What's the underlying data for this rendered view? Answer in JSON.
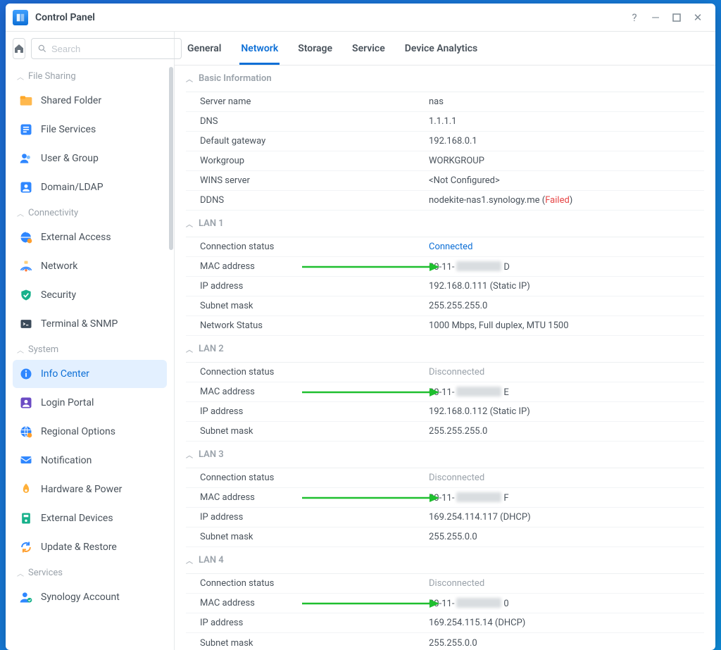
{
  "window": {
    "title": "Control Panel"
  },
  "search": {
    "placeholder": "Search"
  },
  "nav": {
    "sections": [
      {
        "title": "File Sharing",
        "items": [
          {
            "key": "shared-folder",
            "label": "Shared Folder"
          },
          {
            "key": "file-services",
            "label": "File Services"
          },
          {
            "key": "user-group",
            "label": "User & Group"
          },
          {
            "key": "domain-ldap",
            "label": "Domain/LDAP"
          }
        ]
      },
      {
        "title": "Connectivity",
        "items": [
          {
            "key": "external-access",
            "label": "External Access"
          },
          {
            "key": "network",
            "label": "Network"
          },
          {
            "key": "security",
            "label": "Security"
          },
          {
            "key": "terminal-snmp",
            "label": "Terminal & SNMP"
          }
        ]
      },
      {
        "title": "System",
        "items": [
          {
            "key": "info-center",
            "label": "Info Center",
            "active": true
          },
          {
            "key": "login-portal",
            "label": "Login Portal"
          },
          {
            "key": "regional-options",
            "label": "Regional Options"
          },
          {
            "key": "notification",
            "label": "Notification"
          },
          {
            "key": "hardware-power",
            "label": "Hardware & Power"
          },
          {
            "key": "external-devices",
            "label": "External Devices"
          },
          {
            "key": "update-restore",
            "label": "Update & Restore"
          }
        ]
      },
      {
        "title": "Services",
        "items": [
          {
            "key": "synology-account",
            "label": "Synology Account"
          }
        ]
      }
    ]
  },
  "tabs": [
    {
      "key": "general",
      "label": "General"
    },
    {
      "key": "network",
      "label": "Network",
      "active": true
    },
    {
      "key": "storage",
      "label": "Storage"
    },
    {
      "key": "service",
      "label": "Service"
    },
    {
      "key": "device-analytics",
      "label": "Device Analytics"
    }
  ],
  "basic": {
    "title": "Basic Information",
    "rows": {
      "server_name": {
        "label": "Server name",
        "value": "nas"
      },
      "dns": {
        "label": "DNS",
        "value": "1.1.1.1"
      },
      "gateway": {
        "label": "Default gateway",
        "value": "192.168.0.1"
      },
      "workgroup": {
        "label": "Workgroup",
        "value": "WORKGROUP"
      },
      "wins": {
        "label": "WINS server",
        "value": "<Not Configured>"
      },
      "ddns": {
        "label": "DDNS",
        "value": "nodekite-nas1.synology.me (",
        "status": "Failed",
        "suffix": ")"
      }
    }
  },
  "lans": [
    {
      "title": "LAN 1",
      "conn": {
        "label": "Connection status",
        "value": "Connected",
        "state": "connected"
      },
      "mac": {
        "label": "MAC address",
        "prefix": "00-11-",
        "suffix": "D"
      },
      "ip": {
        "label": "IP address",
        "value": "192.168.0.111 (Static IP)"
      },
      "mask": {
        "label": "Subnet mask",
        "value": "255.255.255.0"
      },
      "net": {
        "label": "Network Status",
        "value": "1000 Mbps, Full duplex, MTU 1500"
      }
    },
    {
      "title": "LAN 2",
      "conn": {
        "label": "Connection status",
        "value": "Disconnected",
        "state": "disconnected"
      },
      "mac": {
        "label": "MAC address",
        "prefix": "00-11-",
        "suffix": "E"
      },
      "ip": {
        "label": "IP address",
        "value": "192.168.0.112 (Static IP)"
      },
      "mask": {
        "label": "Subnet mask",
        "value": "255.255.255.0"
      }
    },
    {
      "title": "LAN 3",
      "conn": {
        "label": "Connection status",
        "value": "Disconnected",
        "state": "disconnected"
      },
      "mac": {
        "label": "MAC address",
        "prefix": "00-11-",
        "suffix": "F"
      },
      "ip": {
        "label": "IP address",
        "value": "169.254.114.117 (DHCP)"
      },
      "mask": {
        "label": "Subnet mask",
        "value": "255.255.0.0"
      }
    },
    {
      "title": "LAN 4",
      "conn": {
        "label": "Connection status",
        "value": "Disconnected",
        "state": "disconnected"
      },
      "mac": {
        "label": "MAC address",
        "prefix": "00-11-",
        "suffix": "0"
      },
      "ip": {
        "label": "IP address",
        "value": "169.254.115.14 (DHCP)"
      },
      "mask": {
        "label": "Subnet mask",
        "value": "255.255.0.0"
      }
    }
  ]
}
